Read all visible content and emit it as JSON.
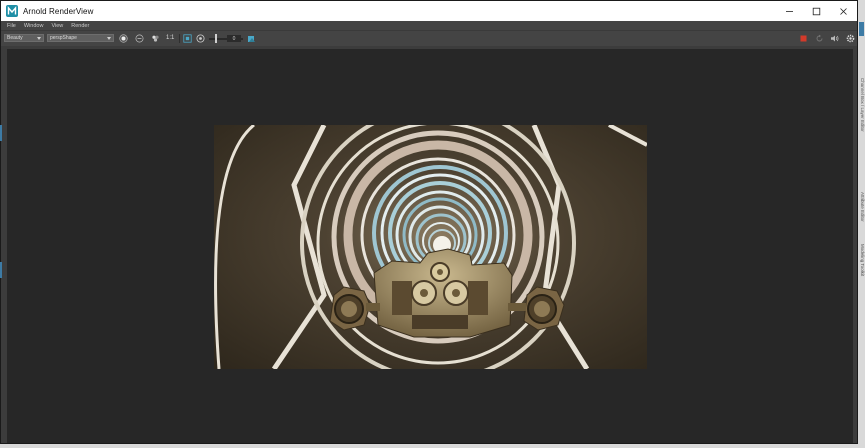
{
  "window": {
    "title": "Arnold RenderView",
    "logo_icon": "maya-m-logo",
    "controls": [
      "minimize-icon",
      "maximize-icon",
      "close-icon"
    ]
  },
  "menu": {
    "items": [
      "File",
      "Window",
      "View",
      "Render"
    ]
  },
  "toolbar": {
    "aov_value": "Beauty",
    "camera_value": "perspShape",
    "ratio_label": "1:1",
    "exposure_value": "0",
    "stop_color": "#d23a2a",
    "accent_color": "#4aa8c8"
  },
  "side_panel": {
    "labels": [
      "Channel Box / Layer Editor",
      "Attribute Editor",
      "Modeling Toolkit"
    ]
  }
}
